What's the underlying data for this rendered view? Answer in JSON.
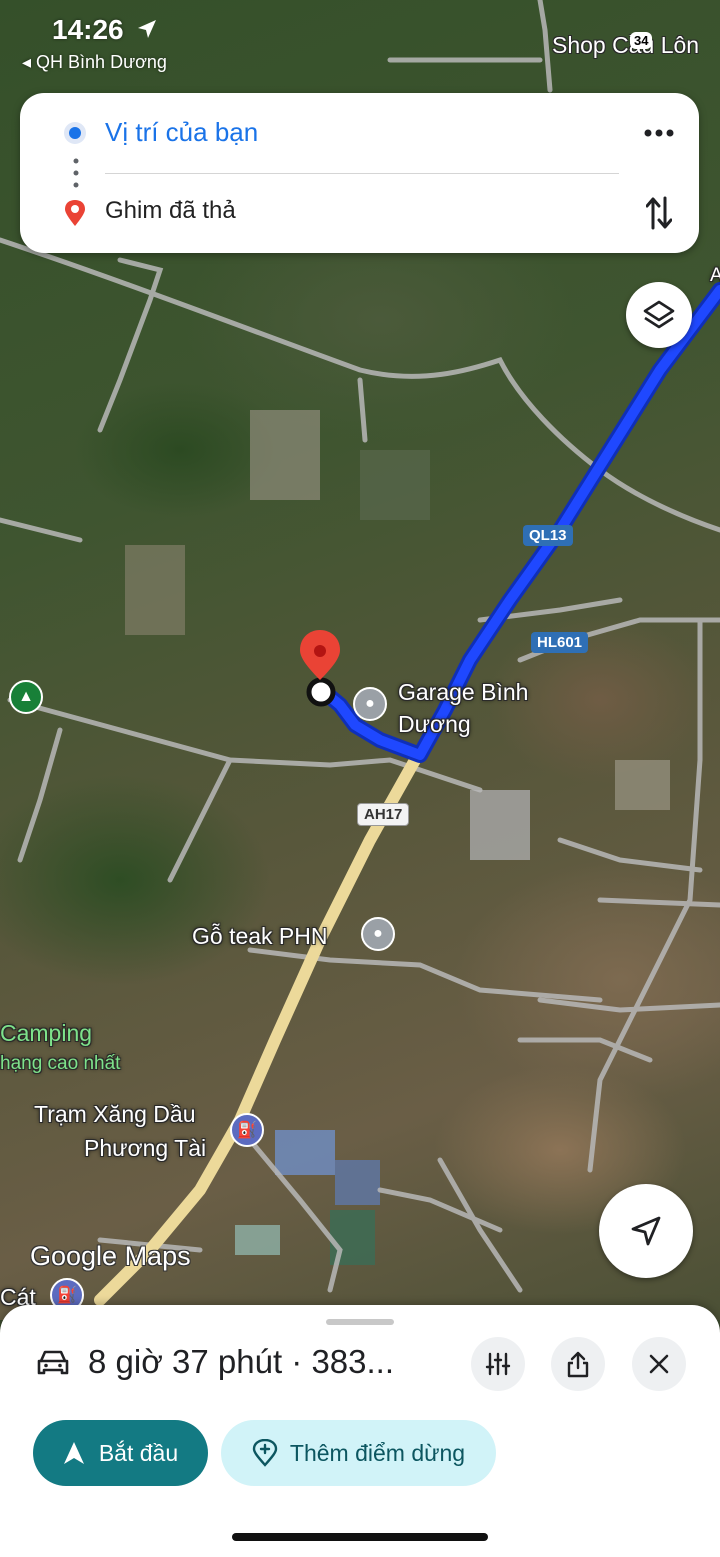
{
  "status_bar": {
    "time": "14:26",
    "back_app": "◂ QH Bình Dương",
    "badge": "34"
  },
  "route_card": {
    "origin": "Vị trí của bạn",
    "destination": "Ghim đã thả"
  },
  "map": {
    "labels": {
      "shop": "Shop Cầu Lôn",
      "garage_line1": "Garage Bình",
      "garage_line2": "Dương",
      "go_teak": "Gỗ teak PHN",
      "camping": "Camping",
      "camping_sub": "hạng cao nhất",
      "gas_line1": "Trạm Xăng Dầu",
      "gas_line2": "Phương Tài",
      "cat": "Cát",
      "a_edge": "A"
    },
    "road_shields": {
      "ql13": "QL13",
      "hl601": "HL601",
      "ah17": "AH17"
    },
    "logo": "Google Maps"
  },
  "sheet": {
    "trip_summary": "8 giờ 37 phút · 383...",
    "start_label": "Bắt đầu",
    "add_stop_label": "Thêm điểm dừng"
  },
  "colors": {
    "route_blue": "#1a3fe0",
    "start_button": "#137a83",
    "add_stop_button": "#d1f3f8",
    "origin_text": "#1a73e8",
    "destination_pin": "#ea4335"
  }
}
